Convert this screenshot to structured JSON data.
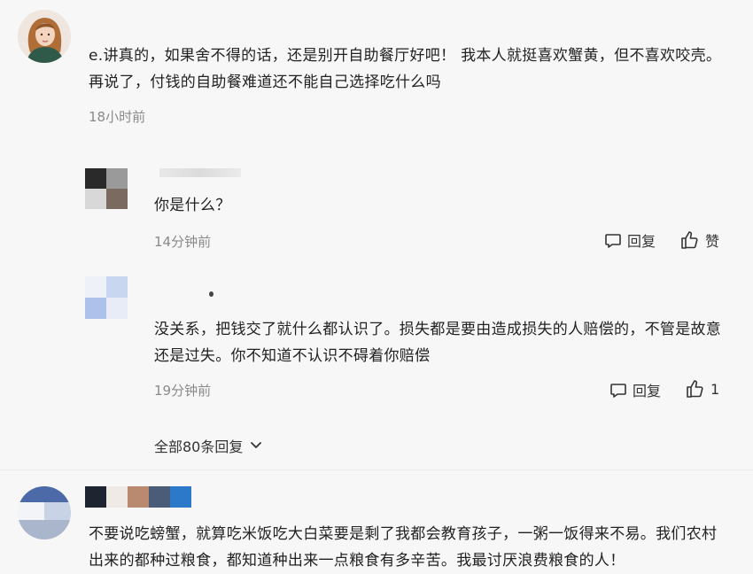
{
  "comments": [
    {
      "text": "e.讲真的，如果舍不得的话，还是别开自助餐厅好吧！ 我本人就挺喜欢蟹黄，但不喜欢咬壳。 再说了，付钱的自助餐难道还不能自己选择吃什么吗",
      "time": "18小时前"
    }
  ],
  "replies": [
    {
      "text": "你是什么？",
      "time": "14分钟前",
      "reply_label": "回复",
      "like_label": "赞"
    },
    {
      "text": "没关系，把钱交了就什么都认识了。损失都是要由造成损失的人赔偿的，不管是故意还是过失。你不知道不认识不碍着你赔偿",
      "time": "19分钟前",
      "reply_label": "回复",
      "like_count": "1"
    }
  ],
  "view_all_replies": "全部80条回复",
  "bottom_comment": {
    "text": "不要说吃螃蟹，就算吃米饭吃大白菜要是剩了我都会教育孩子，一粥一饭得来不易。我们农村出来的都种过粮食，都知道种出来一点粮食有多辛苦。我最讨厌浪费粮食的人！"
  },
  "icons": [
    "avatar-woman-icon",
    "comment-bubble-icon",
    "thumbs-up-icon",
    "chevron-down-icon"
  ]
}
